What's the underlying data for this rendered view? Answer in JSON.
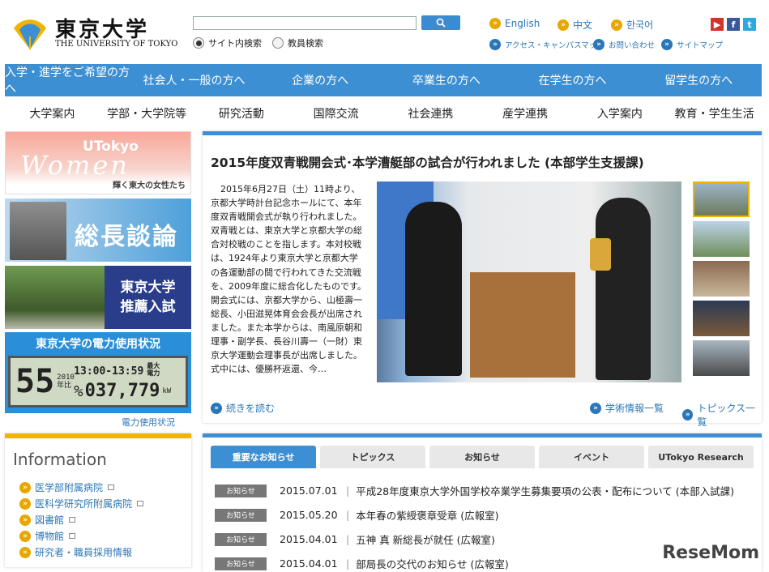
{
  "header": {
    "logo_jp": "東京大学",
    "logo_en": "THE UNIVERSITY OF TOKYO",
    "search_placeholder": "",
    "radio_site": "サイト内検索",
    "radio_staff": "教員検索",
    "lang": [
      "English",
      "中文",
      "한국어"
    ],
    "links": [
      "アクセス・キャンパスマップ",
      "お問い合わせ",
      "サイトマップ"
    ]
  },
  "nav_blue": [
    "入学・進学をご希望の方へ",
    "社会人・一般の方へ",
    "企業の方へ",
    "卒業生の方へ",
    "在学生の方へ",
    "留学生の方へ"
  ],
  "nav_white": [
    "大学案内",
    "学部・大学院等",
    "研究活動",
    "国際交流",
    "社会連携",
    "産学連携",
    "入学案内",
    "教育・学生生活"
  ],
  "banners": {
    "women_top": "UTokyo",
    "women_main": "Women",
    "women_sub": "輝く東大の女性たち",
    "soucho": "総長談論",
    "suisen_1": "東京大学",
    "suisen_2": "推薦入試",
    "power_title": "東京大学の電力使用状況",
    "power_percent": "55",
    "power_year": "2010年比",
    "power_time": "13:00-13:59",
    "power_max": "最大電力",
    "power_kw": "037,779",
    "power_unit": "kW",
    "power_link": "電力使用状況"
  },
  "info": {
    "title": "Information",
    "items": [
      "医学部附属病院",
      "医科学研究所附属病院",
      "図書館",
      "博物館",
      "研究者・職員採用情報"
    ]
  },
  "article": {
    "title": "2015年度双青戦開会式･本学漕艇部の試合が行われました (本部学生支援課)",
    "body": "2015年6月27日（土）11時より、京都大学時計台記念ホールにて、本年度双青戦開会式が執り行われました。　双青戦とは、東京大学と京都大学の総合対校戦のことを指します。本対校戦は、1924年より東京大学と京都大学の各運動部の間で行われてきた交流戦を、2009年度に総合化したものです。　開会式には、京都大学から、山極壽一総長、小田滋晃体育会会長が出席されました。また本学からは、南風原朝和理事・副学長、長谷川壽一（一財）東京大学運動会理事長が出席しました。　式中には、優勝杯返還、今…",
    "more": "続きを読む",
    "link_academic": "学術情報一覧",
    "link_topics": "トピックス一覧"
  },
  "notices": {
    "tabs": [
      "重要なお知らせ",
      "トピックス",
      "お知らせ",
      "イベント",
      "UTokyo Research"
    ],
    "rows": [
      {
        "badge": "お知らせ",
        "date": "2015.07.01",
        "text": "平成28年度東京大学外国学校卒業学生募集要項の公表・配布について (本部入試課)"
      },
      {
        "badge": "お知らせ",
        "date": "2015.05.20",
        "text": "本年春の紫綬褒章受章 (広報室)"
      },
      {
        "badge": "お知らせ",
        "date": "2015.04.01",
        "text": "五神 真 新総長が就任 (広報室)"
      },
      {
        "badge": "お知らせ",
        "date": "2015.04.01",
        "text": "部局長の交代のお知らせ (広報室)"
      }
    ]
  },
  "watermark": "ReseMom",
  "colors": {
    "accent_blue": "#3d8fd3",
    "accent_yellow": "#f2b400",
    "link_blue": "#2a76b6"
  }
}
